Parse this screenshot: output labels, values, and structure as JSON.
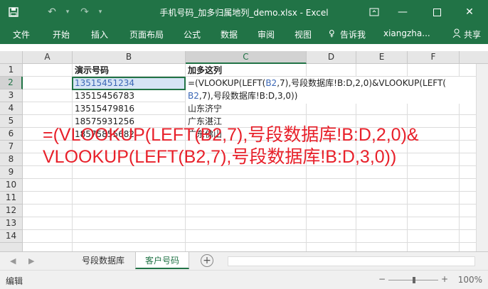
{
  "titlebar": {
    "title": "手机号码_加多归属地列_demo.xlsx - Excel",
    "save_icon": "save-icon",
    "undo_icon": "undo-icon",
    "redo_icon": "redo-icon"
  },
  "ribbon": {
    "tabs": [
      "文件",
      "开始",
      "插入",
      "页面布局",
      "公式",
      "数据",
      "审阅",
      "视图"
    ],
    "tell_me": "告诉我",
    "user": "xiangzha...",
    "share": "共享"
  },
  "grid": {
    "columns": [
      "A",
      "B",
      "C",
      "D",
      "E",
      "F"
    ],
    "rows": [
      "1",
      "2",
      "3",
      "4",
      "5",
      "6",
      "7",
      "8",
      "9",
      "10",
      "11",
      "12",
      "13",
      "14"
    ],
    "header_b": "演示号码",
    "header_c": "加多这列",
    "phones": [
      "13515451234",
      "13515456783",
      "13515479816",
      "18575931256",
      "18575855682"
    ],
    "formula_line1_a": "=(VLOOKUP(LEFT(",
    "formula_ref1": "B2",
    "formula_line1_b": ",7),号段数据库!B:D,2,0)&VLOOKUP(LEFT(",
    "formula_ref2": "B2",
    "formula_line2_b": ",7),号段数据库!B:D,3,0))",
    "regions": [
      "山东济宁",
      "广东湛江",
      "广东佛山"
    ]
  },
  "annotation": {
    "line1": "=(VLOOKUP(LEFT(B2,7),号段数据库!B:D,2,0)&",
    "line2": "VLOOKUP(LEFT(B2,7),号段数据库!B:D,3,0))"
  },
  "sheets": {
    "tabs": [
      "号段数据库",
      "客户号码"
    ],
    "active": "客户号码"
  },
  "status": {
    "mode": "编辑",
    "zoom": "100%"
  },
  "colors": {
    "accent": "#217346",
    "annotation": "#e8202a",
    "selection": "#d6e4f5"
  }
}
